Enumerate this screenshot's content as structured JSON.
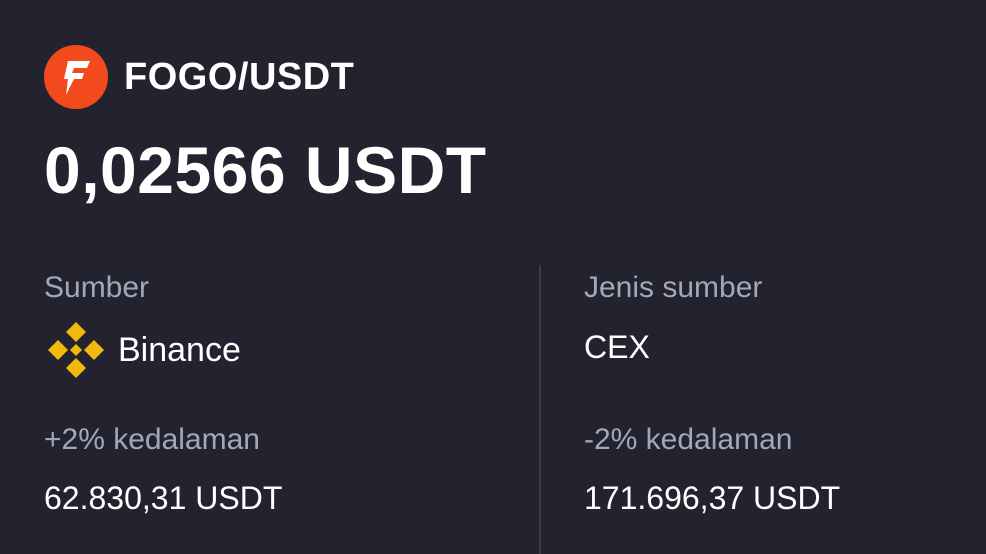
{
  "header": {
    "pair": "FOGO/USDT",
    "logo_icon": "fogo-logo-icon",
    "brand_color": "#f24a1d"
  },
  "price": "0,02566 USDT",
  "source": {
    "label": "Sumber",
    "name": "Binance",
    "icon": "binance-logo-icon",
    "icon_color": "#f0b90b"
  },
  "source_type": {
    "label": "Jenis sumber",
    "value": "CEX"
  },
  "depth_plus": {
    "label": "+2% kedalaman",
    "value": "62.830,31 USDT"
  },
  "depth_minus": {
    "label": "-2% kedalaman",
    "value": "171.696,37 USDT"
  }
}
